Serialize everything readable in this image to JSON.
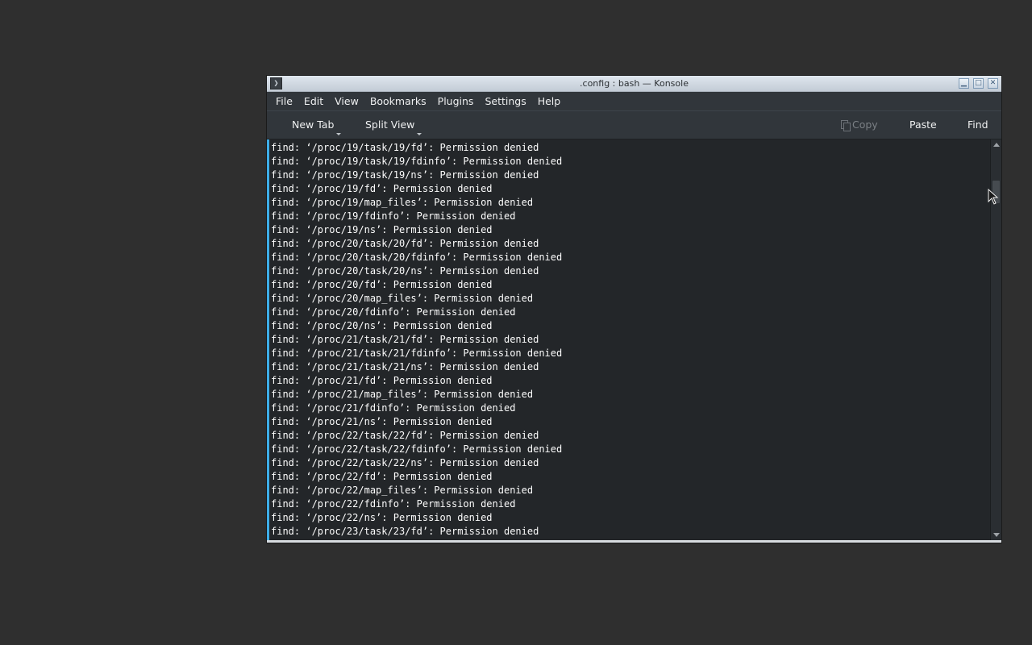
{
  "window": {
    "title": ".config : bash — Konsole",
    "app_icon_glyph": "❯",
    "controls": [
      "minimize",
      "maximize",
      "close"
    ]
  },
  "menubar": {
    "items": [
      "File",
      "Edit",
      "View",
      "Bookmarks",
      "Plugins",
      "Settings",
      "Help"
    ]
  },
  "toolbar": {
    "new_tab_label": "New Tab",
    "split_view_label": "Split View",
    "copy_label": "Copy",
    "paste_label": "Paste",
    "find_label": "Find"
  },
  "terminal": {
    "lines": [
      "find: ‘/proc/19/task/19/fd’: Permission denied",
      "find: ‘/proc/19/task/19/fdinfo’: Permission denied",
      "find: ‘/proc/19/task/19/ns’: Permission denied",
      "find: ‘/proc/19/fd’: Permission denied",
      "find: ‘/proc/19/map_files’: Permission denied",
      "find: ‘/proc/19/fdinfo’: Permission denied",
      "find: ‘/proc/19/ns’: Permission denied",
      "find: ‘/proc/20/task/20/fd’: Permission denied",
      "find: ‘/proc/20/task/20/fdinfo’: Permission denied",
      "find: ‘/proc/20/task/20/ns’: Permission denied",
      "find: ‘/proc/20/fd’: Permission denied",
      "find: ‘/proc/20/map_files’: Permission denied",
      "find: ‘/proc/20/fdinfo’: Permission denied",
      "find: ‘/proc/20/ns’: Permission denied",
      "find: ‘/proc/21/task/21/fd’: Permission denied",
      "find: ‘/proc/21/task/21/fdinfo’: Permission denied",
      "find: ‘/proc/21/task/21/ns’: Permission denied",
      "find: ‘/proc/21/fd’: Permission denied",
      "find: ‘/proc/21/map_files’: Permission denied",
      "find: ‘/proc/21/fdinfo’: Permission denied",
      "find: ‘/proc/21/ns’: Permission denied",
      "find: ‘/proc/22/task/22/fd’: Permission denied",
      "find: ‘/proc/22/task/22/fdinfo’: Permission denied",
      "find: ‘/proc/22/task/22/ns’: Permission denied",
      "find: ‘/proc/22/fd’: Permission denied",
      "find: ‘/proc/22/map_files’: Permission denied",
      "find: ‘/proc/22/fdinfo’: Permission denied",
      "find: ‘/proc/22/ns’: Permission denied",
      "find: ‘/proc/23/task/23/fd’: Permission denied"
    ]
  },
  "colors": {
    "accent": "#3daee9",
    "terminal_bg": "#232629",
    "terminal_fg": "#fcfcfc",
    "chrome_bg": "#31363b"
  }
}
